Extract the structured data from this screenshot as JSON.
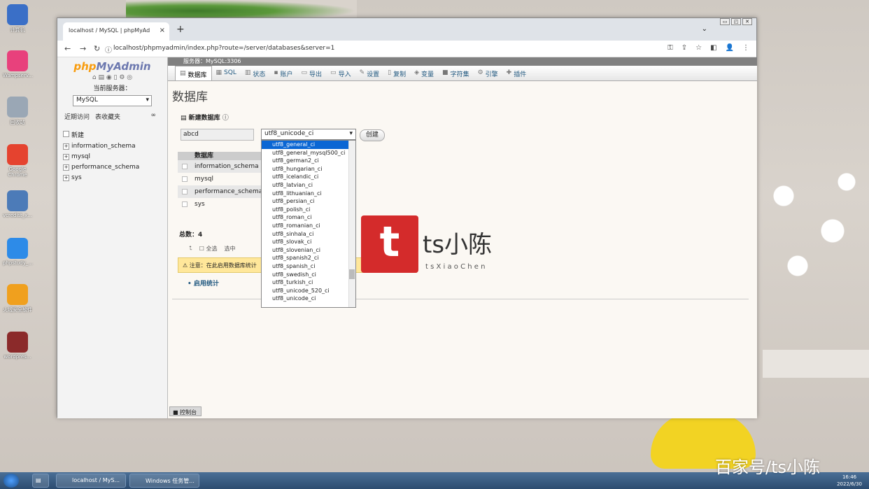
{
  "desktop_icons": [
    {
      "label": "计算机",
      "color": "#3a6fc7"
    },
    {
      "label": "Wampserv...",
      "color": "#e8417c"
    },
    {
      "label": "回收站",
      "color": "#9aa7b5"
    },
    {
      "label": "Google Chrome",
      "color": "#e5432f"
    },
    {
      "label": "vcredist_x...",
      "color": "#4c7bb8"
    },
    {
      "label": "phpstudy_...",
      "color": "#2d8be8"
    },
    {
      "label": "火绒安全软件",
      "color": "#f0a01e"
    },
    {
      "label": "wordpres...",
      "color": "#8b2a2a"
    }
  ],
  "browser": {
    "tab_title": "localhost / MySQL | phpMyAd",
    "close": "×",
    "new_tab": "+",
    "menu_chevron": "⌄",
    "url": "localhost/phpmyadmin/index.php?route=/server/databases&server=1",
    "back": "←",
    "forward": "→",
    "reload": "↻",
    "info": "ⓘ",
    "tools": [
      "⚿",
      "⇪",
      "☆",
      "◧",
      "👤",
      "⋮"
    ],
    "window_controls": [
      "▭",
      "◰",
      "✕"
    ]
  },
  "sidebar": {
    "logo_php": "php",
    "logo_rest": "MyAdmin",
    "quick_icons": "⌂ ▤ ◉ ▯ ⚙ ◎",
    "server_label": "当前服务器：",
    "server_value": "MySQL",
    "tab_recent": "近期访问",
    "tab_fav": "表收藏夹",
    "link_icon": "∞",
    "tree": [
      {
        "label": "新建",
        "pm": ""
      },
      {
        "label": "information_schema",
        "pm": "+"
      },
      {
        "label": "mysql",
        "pm": "+"
      },
      {
        "label": "performance_schema",
        "pm": "+"
      },
      {
        "label": "sys",
        "pm": "+"
      }
    ],
    "console": "控制台"
  },
  "main": {
    "server_bar": "服务器：MySQL:3306",
    "menu": [
      {
        "icon": "▤",
        "label": "数据库"
      },
      {
        "icon": "▦",
        "label": "SQL"
      },
      {
        "icon": "▥",
        "label": "状态"
      },
      {
        "icon": "▪",
        "label": "账户"
      },
      {
        "icon": "▭",
        "label": "导出"
      },
      {
        "icon": "▭",
        "label": "导入"
      },
      {
        "icon": "✎",
        "label": "设置"
      },
      {
        "icon": "▯",
        "label": "复制"
      },
      {
        "icon": "◈",
        "label": "变量"
      },
      {
        "icon": "■",
        "label": "字符集"
      },
      {
        "icon": "⚙",
        "label": "引擎"
      },
      {
        "icon": "✚",
        "label": "插件"
      }
    ],
    "title": "数据库",
    "new_db_label": "新建数据库",
    "db_name_value": "abcd",
    "collation_value": "utf8_unicode_ci",
    "create_button": "创建",
    "table_header": "数据库",
    "databases": [
      "information_schema",
      "mysql",
      "performance_schema",
      "sys"
    ],
    "total": "总数：4",
    "check_all": "全选",
    "selected": "选中",
    "notice": "注意：在此启用数据库统计",
    "enable_stats": "启用统计"
  },
  "dropdown": {
    "options": [
      "utf8_general_ci",
      "utf8_general_mysql500_ci",
      "utf8_german2_ci",
      "utf8_hungarian_ci",
      "utf8_icelandic_ci",
      "utf8_latvian_ci",
      "utf8_lithuanian_ci",
      "utf8_persian_ci",
      "utf8_polish_ci",
      "utf8_roman_ci",
      "utf8_romanian_ci",
      "utf8_sinhala_ci",
      "utf8_slovak_ci",
      "utf8_slovenian_ci",
      "utf8_spanish2_ci",
      "utf8_spanish_ci",
      "utf8_swedish_ci",
      "utf8_turkish_ci",
      "utf8_unicode_520_ci",
      "utf8_unicode_ci"
    ],
    "selected_index": 0
  },
  "watermark": {
    "logo": "t",
    "text": "ts小陈",
    "sub": "t s  X i a o  C h e n"
  },
  "taskbar": {
    "items": [
      "localhost / MyS...",
      "Windows 任务管..."
    ],
    "time": "16:46",
    "date": "2022/6/30"
  },
  "brand": "百家号/ts小陈"
}
